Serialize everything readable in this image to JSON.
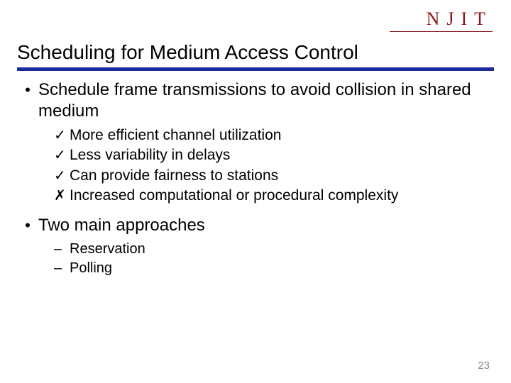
{
  "logo": "NJIT",
  "title": "Scheduling for Medium Access Control",
  "bullets": [
    {
      "text": "Schedule frame transmissions to avoid collision in shared medium",
      "subs": [
        {
          "mark": "✓",
          "text": "More efficient channel utilization"
        },
        {
          "mark": "✓",
          "text": "Less variability in delays"
        },
        {
          "mark": "✓",
          "text": "Can provide fairness to stations"
        },
        {
          "mark": "✗",
          "text": "Increased computational or procedural complexity"
        }
      ]
    },
    {
      "text": "Two main approaches",
      "dashes": [
        "Reservation",
        "Polling"
      ]
    }
  ],
  "page_number": "23"
}
